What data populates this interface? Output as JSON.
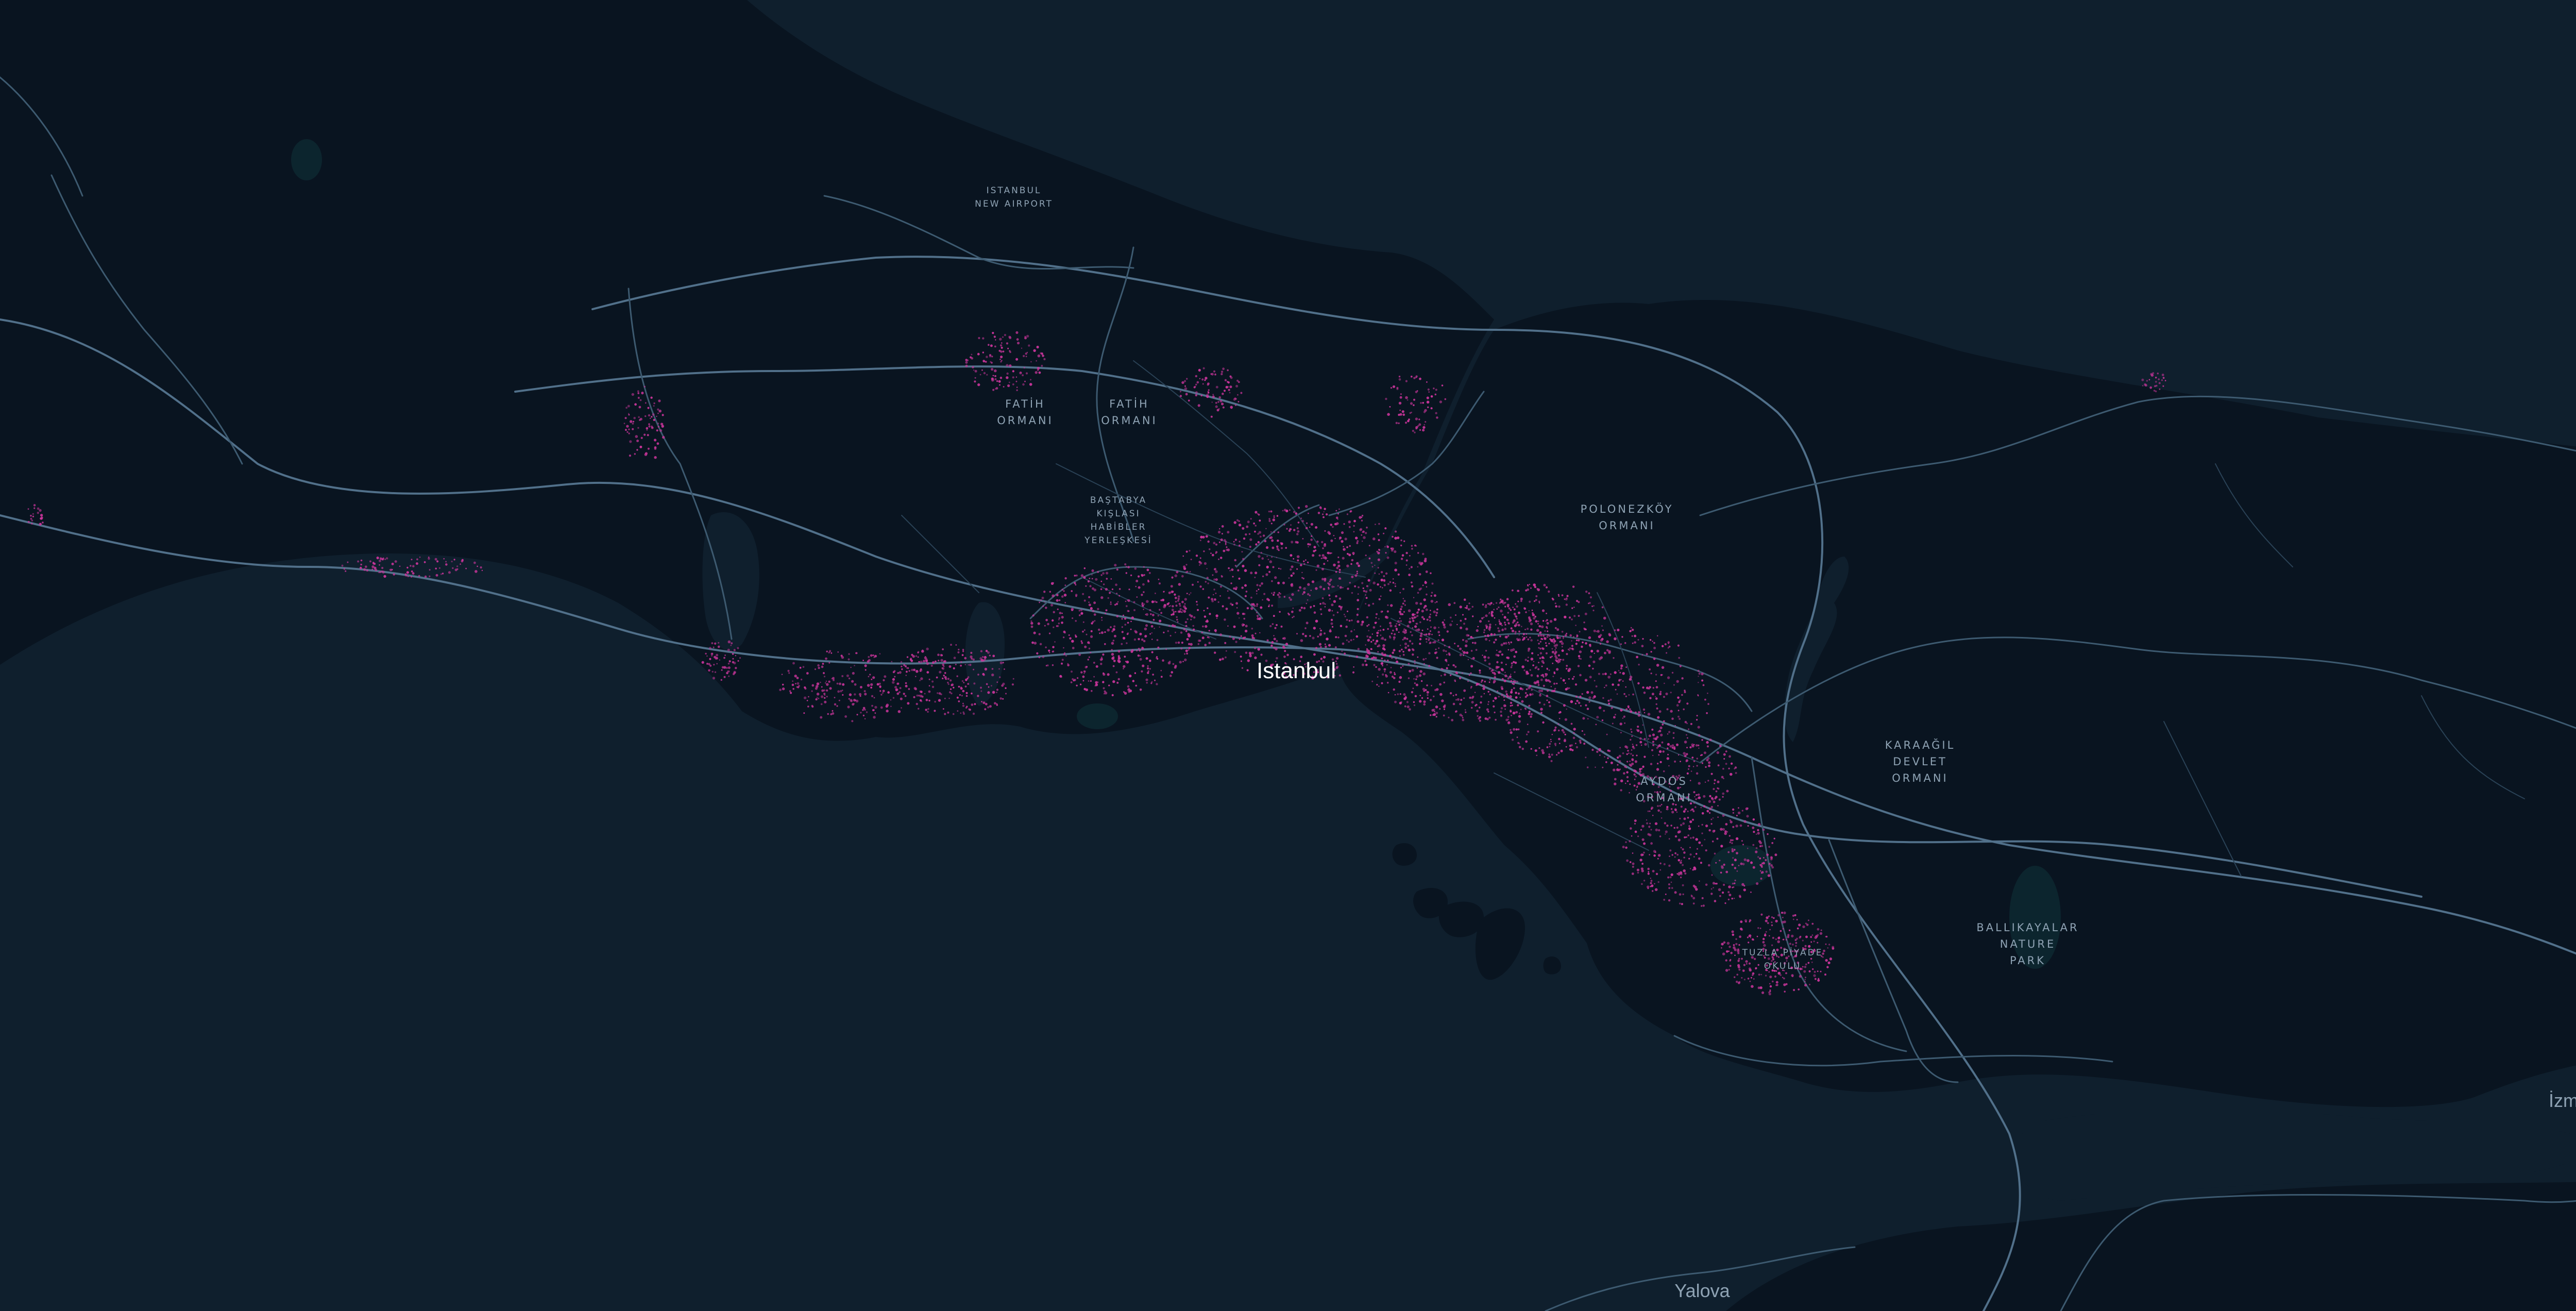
{
  "map": {
    "colors": {
      "water": "#0f1f2d",
      "land": "#091420",
      "road": "#3d5a70",
      "highway": "#51708a",
      "forest": "#0d2730",
      "points": "#c8359a"
    },
    "labels": {
      "city_major": {
        "istanbul": "Istanbul"
      },
      "city_minor": {
        "yalova": "Yalova",
        "izmit": "İzmit"
      },
      "poi": {
        "airport": "ISTANBUL\nNEW AIRPORT",
        "fatih_west": "FATİH\nORMANI",
        "fatih_east": "FATİH\nORMANI",
        "bastabya": "BAŞTABYA\nKIŞLASI\nHABİBLER\nYERLEŞKESİ",
        "polonezkoy": "POLONEZKÖY\nORMANI",
        "karaagil": "KARAAĞIL\nDEVLET\nORMANI",
        "aydos": "AYDOS\nORMANI",
        "tuzla": "TUZLA PİYADE\nOKULU",
        "ballikayalar": "BALLIKAYALAR\nNATURE\nPARK"
      }
    },
    "data_layer": {
      "type": "point-density",
      "color": "#c8359a"
    }
  }
}
